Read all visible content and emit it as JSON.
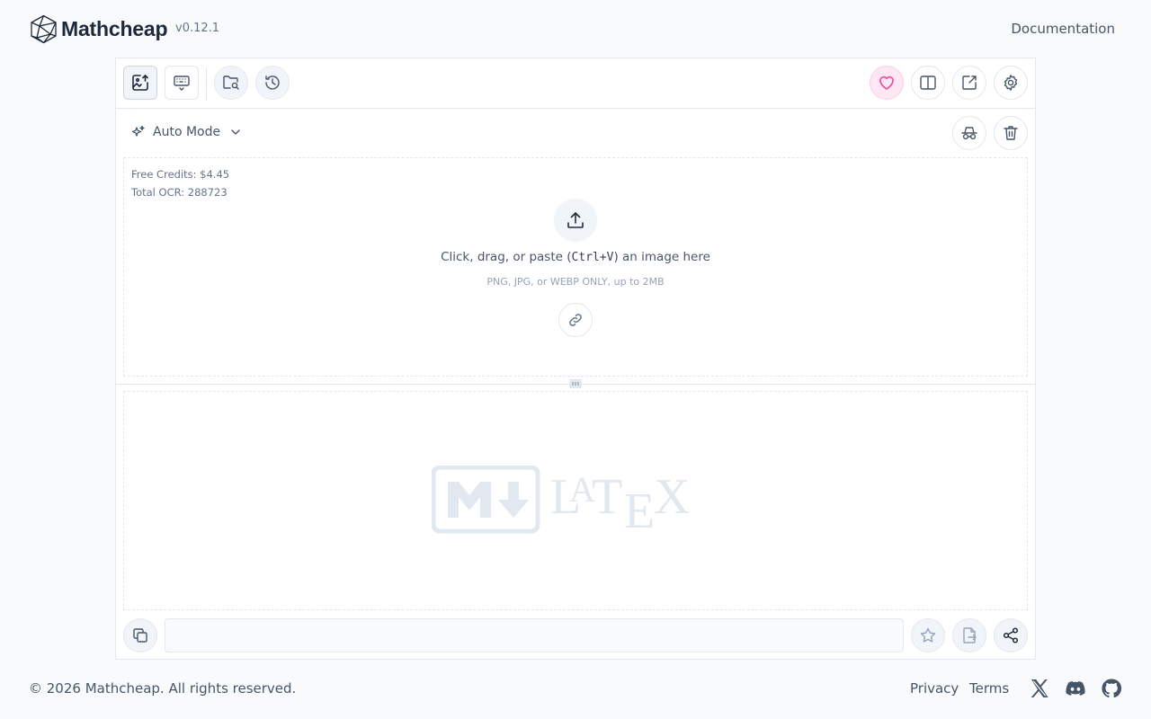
{
  "header": {
    "brand": "Mathcheap",
    "version": "v0.12.1",
    "doc_link": "Documentation"
  },
  "toolbar": {
    "left_icons": [
      "image-upload-icon",
      "keyboard-icon",
      "folder-search-icon",
      "history-icon"
    ],
    "right_icons": [
      "heart-icon",
      "split-view-icon",
      "external-open-icon",
      "gear-icon"
    ]
  },
  "mode": {
    "label": "Auto Mode",
    "icons": [
      "sparkles-icon",
      "chevron-down-icon",
      "incognito-icon",
      "trash-icon"
    ]
  },
  "upload": {
    "credits_line": "Free Credits: $4.45",
    "ocr_line": "Total OCR: 288723",
    "prompt_before": "Click, drag, or paste (",
    "prompt_kbd": "Ctrl+V",
    "prompt_after": ") an image here",
    "hint": "PNG, JPG, or WEBP ONLY, up to 2MB"
  },
  "output": {
    "watermark_md": "markdown-logo",
    "watermark_latex": "LaTeX"
  },
  "bottom": {
    "input_value": "",
    "icons": [
      "copy-icon",
      "star-icon",
      "file-export-icon",
      "share-icon"
    ]
  },
  "footer": {
    "copyright": "© 2026 Mathcheap. All rights reserved.",
    "privacy": "Privacy",
    "terms": "Terms",
    "social": [
      "x-icon",
      "discord-icon",
      "github-icon"
    ]
  },
  "colors": {
    "background": "#f8fafc",
    "border": "#e2e8f0",
    "accent_pink": "#ec4899",
    "text": "#1e293b"
  }
}
